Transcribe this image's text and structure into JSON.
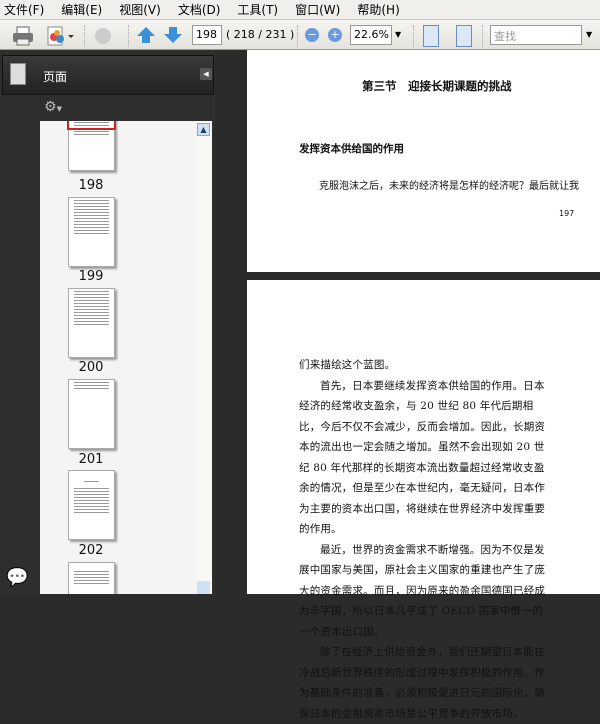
{
  "menu": [
    "文件(F)",
    "编辑(E)",
    "视图(V)",
    "文档(D)",
    "工具(T)",
    "窗口(W)",
    "帮助(H)"
  ],
  "toolbar": {
    "page_input": "198",
    "page_count": "( 218 / 231 )",
    "zoom": "22.6%",
    "search_placeholder": "查找"
  },
  "panel": {
    "title": "页面"
  },
  "thumbnails": [
    "198",
    "199",
    "200",
    "201",
    "202"
  ],
  "doc": {
    "page1": {
      "heading": "第三节　迎接长期课题的挑战",
      "subheading": "发挥资本供给国的作用",
      "text": "克服泡沫之后，未来的经济将是怎样的经济呢？最后就让我",
      "page_number": "197"
    },
    "page2": {
      "paragraphs": [
        "们来描绘这个蓝图。",
        "首先，日本要继续发挥资本供给国的作用。日本经济的经常收支盈余，与 20 世纪 80 年代后期相比，今后不仅不会减少，反而会增加。因此，长期资本的流出也一定会随之增加。虽然不会出现如 20 世纪 80 年代那样的长期资本流出数量超过经常收支盈余的情况，但是至少在本世纪内，毫无疑问，日本作为主要的资本出口国，将继续在世界经济中发挥重要的作用。",
        "最近，世界的资金需求不断增强。因为不仅是发展中国家与美国，原社会主义国家的重建也产生了庞大的资金需求。而且，因为原来的盈余国德国已经成为赤字国，所以日本几乎成了 OECD 国家中惟一的一个资本出口国。",
        "除了在经济上供给资金外，我们还期望日本能在冷战后新世界秩序的形成过程中发挥积极的作用。作为基础条件的准备，必须积极促进日元的国际化，确保日本的金融资本市场是公平竞争的开放市场。"
      ]
    }
  }
}
